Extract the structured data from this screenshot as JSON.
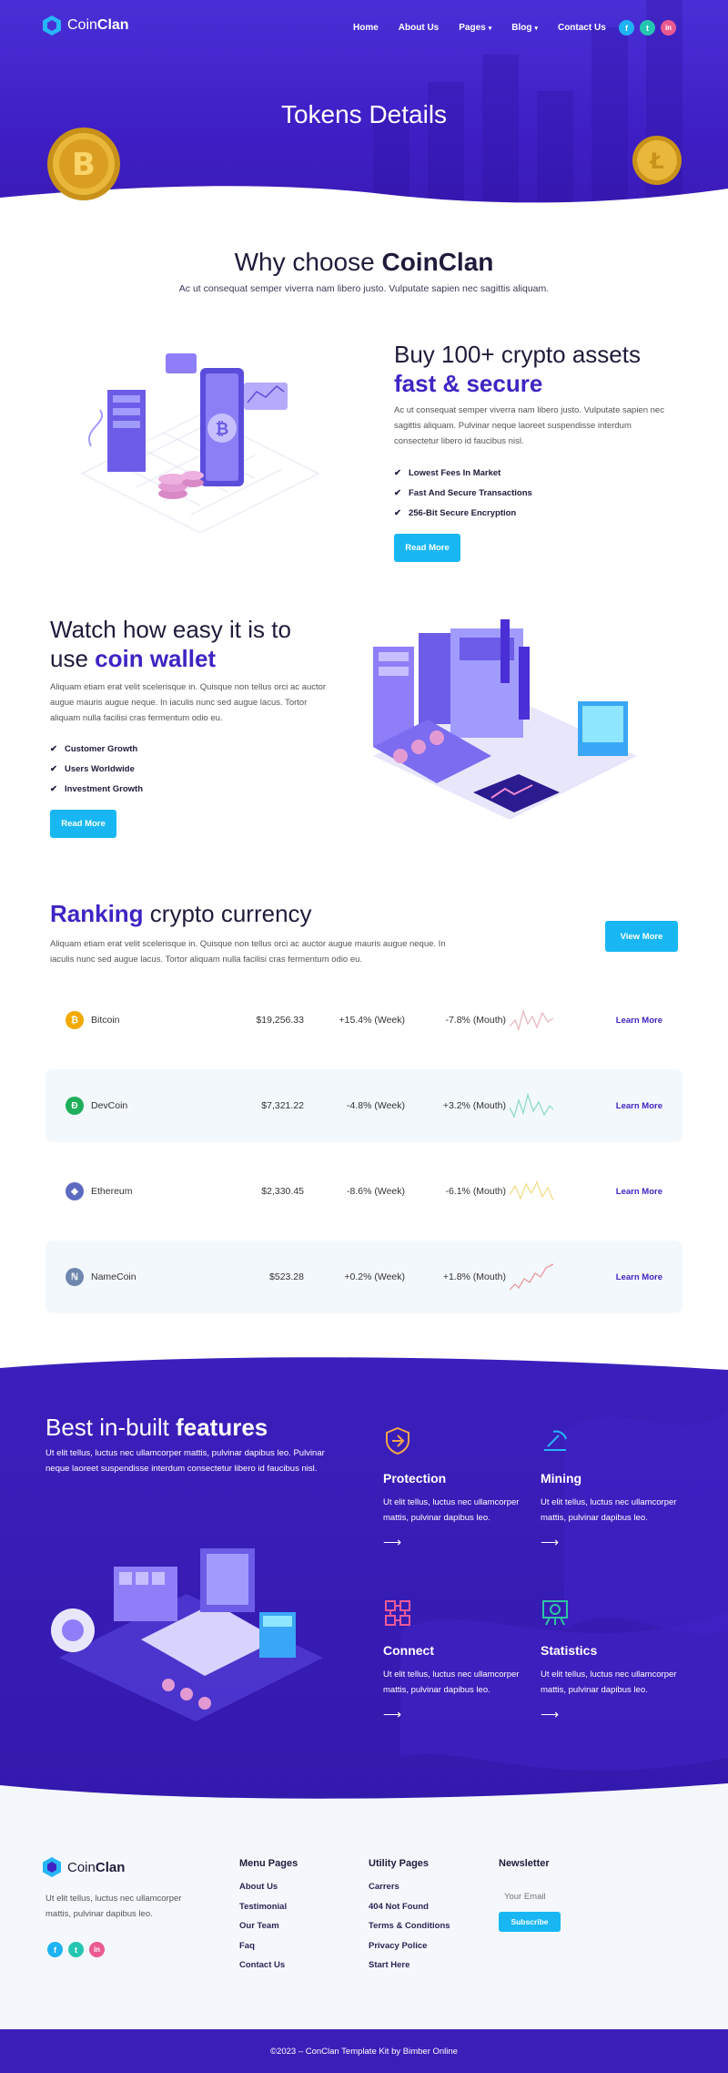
{
  "brand": {
    "name_light": "Coin",
    "name_bold": "Clan"
  },
  "nav": {
    "items": [
      "Home",
      "About Us",
      "Pages",
      "Blog",
      "Contact Us"
    ],
    "caret": "▾"
  },
  "social": {
    "facebook": "f",
    "twitter": "t",
    "linkedin": "in"
  },
  "hero": {
    "title": "Tokens Details"
  },
  "why": {
    "title_light": "Why choose ",
    "title_bold": "CoinClan",
    "subtitle": "Ac ut consequat semper viverra nam libero justo. Vulputate sapien nec sagittis aliquam."
  },
  "block1": {
    "title_light": "Buy 100+ crypto assets",
    "title_bold": "fast & secure",
    "text": "Ac ut consequat semper viverra nam libero justo. Vulputate sapien nec sagittis aliquam. Pulvinar neque laoreet suspendisse interdum consectetur libero id faucibus nisl.",
    "checks": [
      "Lowest Fees In Market",
      "Fast And Secure Transactions",
      "256-Bit Secure Encryption"
    ],
    "button": "Read More"
  },
  "block2": {
    "title_light_1": "Watch how easy it is to",
    "title_light_2": "use ",
    "title_bold": "coin wallet",
    "text": "Aliquam etiam erat velit scelerisque in. Quisque non tellus orci ac auctor augue mauris augue neque. In iaculis nunc sed augue lacus. Tortor aliquam nulla facilisi cras fermentum odio eu.",
    "checks": [
      "Customer Growth",
      "Users Worldwide",
      "Investment Growth"
    ],
    "button": "Read More"
  },
  "ranking": {
    "title_bold": "Ranking",
    "title_light": " crypto currency",
    "text": "Aliquam etiam erat velit scelerisque in. Quisque non tellus orci ac auctor augue mauris augue neque. In iaculis nunc sed augue lacus. Tortor aliquam nulla facilisi cras fermentum odio eu.",
    "button": "View More",
    "rows": [
      {
        "name": "Bitcoin",
        "symbol": "₿",
        "color": "#f2a900",
        "price": "$19,256.33",
        "week": "+15.4% (Week)",
        "month": "-7.8% (Mouth)",
        "link": "Learn More",
        "spark_color": "#e9b8c0"
      },
      {
        "name": "DevCoin",
        "symbol": "Đ",
        "color": "#1fae5b",
        "price": "$7,321.22",
        "week": "-4.8% (Week)",
        "month": "+3.2% (Mouth)",
        "link": "Learn More",
        "spark_color": "#8fdcc8"
      },
      {
        "name": "Ethereum",
        "symbol": "◆",
        "color": "#5c6bc0",
        "price": "$2,330.45",
        "week": "-8.6% (Week)",
        "month": "-6.1% (Mouth)",
        "link": "Learn More",
        "spark_color": "#f1dd8a"
      },
      {
        "name": "NameCoin",
        "symbol": "ℕ",
        "color": "#6f87ad",
        "price": "$523.28",
        "week": "+0.2% (Week)",
        "month": "+1.8% (Mouth)",
        "link": "Learn More",
        "spark_color": "#e79a9a"
      }
    ]
  },
  "features": {
    "title_light": "Best in-built ",
    "title_bold": "features",
    "text": "Ut elit tellus, luctus nec ullamcorper mattis, pulvinar dapibus leo. Pulvinar neque laoreet suspendisse interdum consectetur libero id faucibus nisl.",
    "cards": [
      {
        "title": "Protection",
        "text": "Ut elit tellus, luctus nec ullamcorper mattis, pulvinar dapibus leo.",
        "arrow": "⟶"
      },
      {
        "title": "Mining",
        "text": "Ut elit tellus, luctus nec ullamcorper mattis, pulvinar dapibus leo.",
        "arrow": "⟶"
      },
      {
        "title": "Connect",
        "text": "Ut elit tellus, luctus nec ullamcorper mattis, pulvinar dapibus leo.",
        "arrow": "⟶"
      },
      {
        "title": "Statistics",
        "text": "Ut elit tellus, luctus nec ullamcorper mattis, pulvinar dapibus leo.",
        "arrow": "⟶"
      }
    ]
  },
  "footer": {
    "about": "Ut elit tellus, luctus nec ullamcorper mattis, pulvinar dapibus leo.",
    "menu": {
      "title": "Menu Pages",
      "items": [
        "About Us",
        "Testimonial",
        "Our Team",
        "Faq",
        "Contact Us"
      ]
    },
    "utility": {
      "title": "Utility Pages",
      "items": [
        "Carrers",
        "404 Not Found",
        "Terms & Conditions",
        "Privacy Police",
        "Start Here"
      ]
    },
    "newsletter": {
      "title": "Newsletter",
      "placeholder": "Your Email",
      "button": "Subscribe"
    },
    "copyright": "©2023 – ConClan Template Kit by Bimber Online"
  },
  "colors": {
    "primary": "#3f24c3",
    "accent": "#18b7f3",
    "hero": "#4a2fd6"
  }
}
